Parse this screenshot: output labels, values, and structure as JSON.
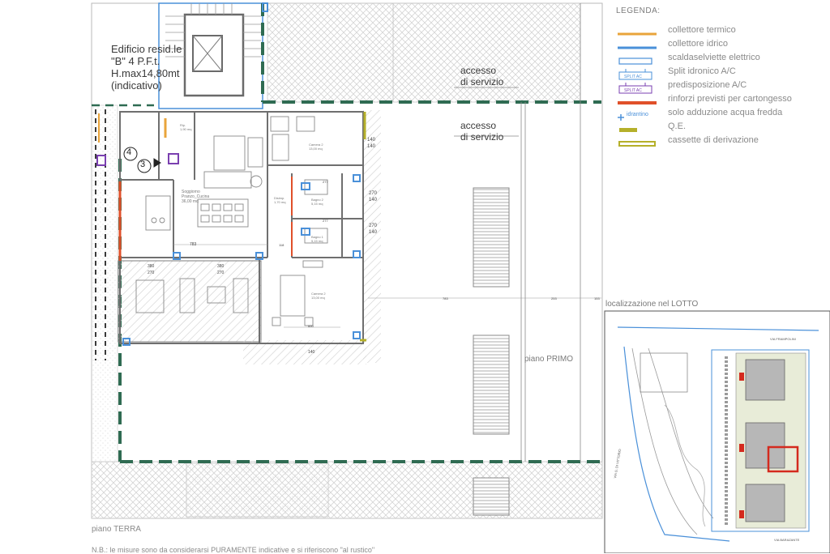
{
  "building": {
    "name_line1": "Edificio resid.le",
    "name_line2": "\"B\" 4 P.F.t.",
    "name_line3": "H.max14,80mt",
    "name_line4": "(indicativo)"
  },
  "access_labels": [
    {
      "line1": "accesso",
      "line2": "di servizio"
    },
    {
      "line1": "accesso",
      "line2": "di servizio"
    }
  ],
  "markers": [
    "4",
    "3"
  ],
  "floor_labels": {
    "first": "piano PRIMO",
    "ground": "piano TERRA"
  },
  "footnote": "N.B.: le misure sono da considerarsi PURAMENTE indicative e si riferiscono \"al rustico\"",
  "rooms": {
    "soggiorno": "Soggiorno\nPranzo_Cucina\n36,00 mq",
    "camera2_top": "Camera 2\n13,00 mq",
    "bagno2": "Bagno 2\n5,15 mq",
    "bagno1": "Bagno 1\n5,15 mq",
    "disimp": "Disimp.\n1,70 mq",
    "rip": "Rip.\n1,90 mq",
    "camera2_bottom": "Camera 2\n13,00 mq"
  },
  "dimensions": [
    "140",
    "140",
    "270",
    "140",
    "270",
    "140",
    "783",
    "380",
    "270",
    "380",
    "270",
    "277",
    "277",
    "783",
    "253",
    "153",
    "140",
    "600",
    "118"
  ],
  "legend": {
    "title": "LEGENDA:",
    "items": [
      {
        "label": "collettore termico",
        "symbol": "thermal-line-icon",
        "color": "#e9a43b"
      },
      {
        "label": "collettore idrico",
        "symbol": "water-line-icon",
        "color": "#4a90d9"
      },
      {
        "label": "scaldaselviette elettrico",
        "symbol": "towel-heater-icon",
        "color": "#4a90d9"
      },
      {
        "label": "Split idronico A/C",
        "symbol": "split-ac-icon",
        "color": "#4a90d9",
        "tag": "SPLIT AC"
      },
      {
        "label": "predisposizione A/C",
        "symbol": "ac-prep-icon",
        "color": "#7a3fb0",
        "tag": "SPLIT AC"
      },
      {
        "label": "rinforzi previsti per cartongesso",
        "symbol": "reinforcement-line-icon",
        "color": "#e0502a"
      },
      {
        "label": "solo adduzione acqua fredda",
        "symbol": "cold-water-icon",
        "color": "#4a90d9",
        "tag": "idrantino"
      },
      {
        "label": "Q.E.",
        "symbol": "electric-panel-icon",
        "color": "#b5b02a"
      },
      {
        "label": "cassette di derivazione",
        "symbol": "junction-box-icon",
        "color": "#b5b02a"
      }
    ]
  },
  "location": {
    "title": "localizzazione nel LOTTO",
    "streets": [
      "VIA FRAMPOLINI",
      "VIA G. DI VITTORIO",
      "VIA BARAZANTE"
    ]
  },
  "colors": {
    "wall": "#7d7d7d",
    "boundary": "#2f6b52",
    "highlight": "#d42a1e",
    "hatch": "#cfcfcf"
  }
}
